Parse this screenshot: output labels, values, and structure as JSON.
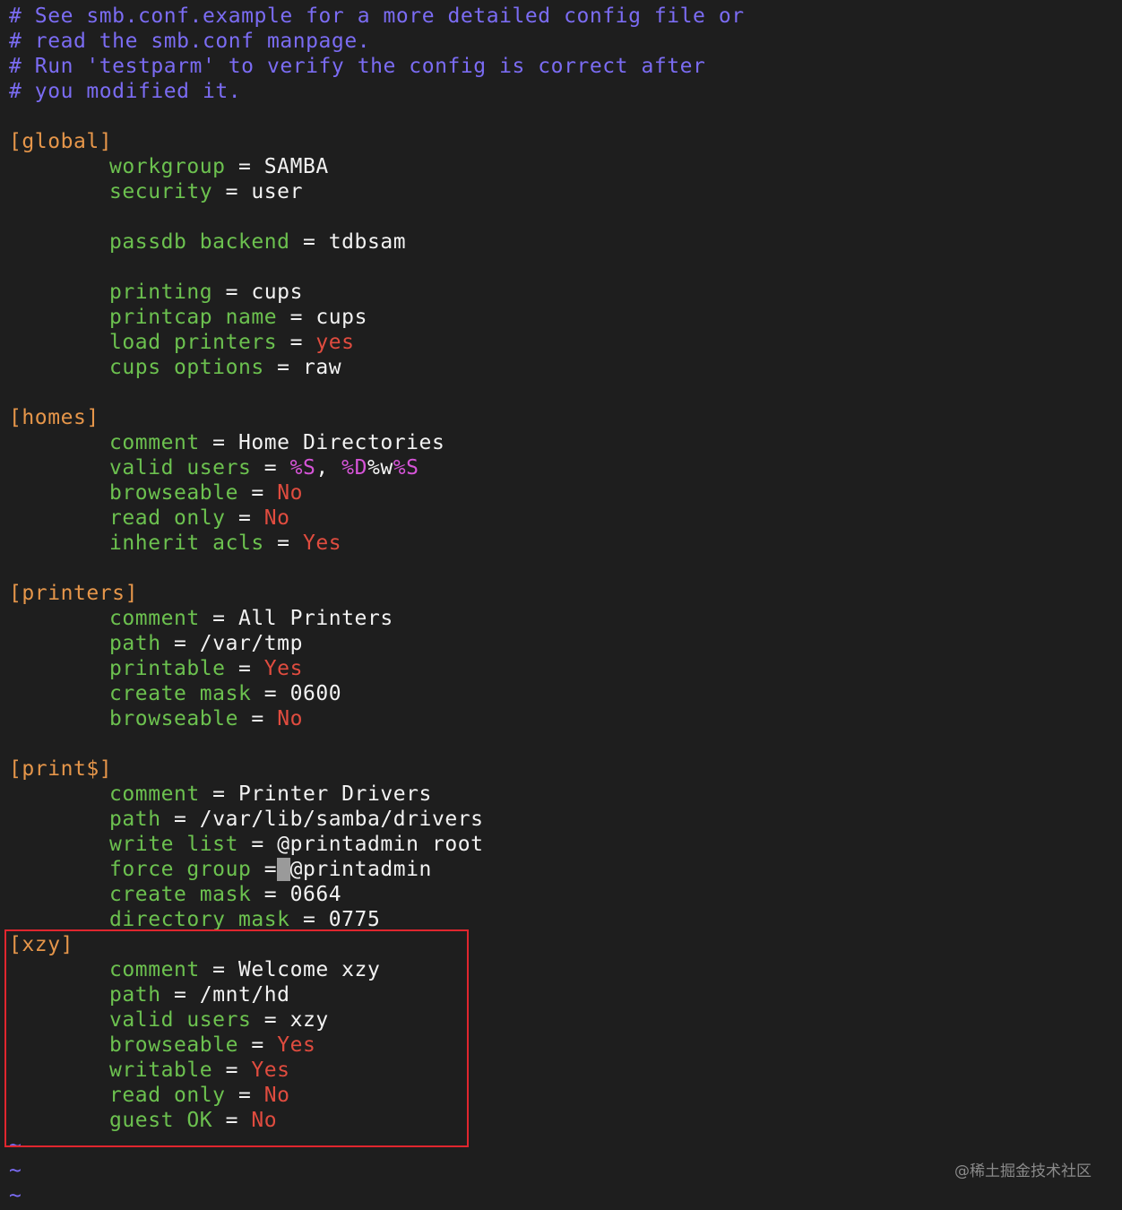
{
  "editor": {
    "lines": [
      {
        "kind": "comment",
        "text": "# See smb.conf.example for a more detailed config file or"
      },
      {
        "kind": "comment",
        "text": "# read the smb.conf manpage."
      },
      {
        "kind": "comment",
        "text": "# Run 'testparm' to verify the config is correct after"
      },
      {
        "kind": "comment",
        "text": "# you modified it."
      },
      {
        "kind": "blank"
      },
      {
        "kind": "section",
        "text": "[global]"
      },
      {
        "kind": "kv",
        "key": "workgroup",
        "parts": [
          {
            "t": "SAMBA",
            "c": "val"
          }
        ]
      },
      {
        "kind": "kv",
        "key": "security",
        "parts": [
          {
            "t": "user",
            "c": "val"
          }
        ]
      },
      {
        "kind": "blank"
      },
      {
        "kind": "kv",
        "key": "passdb backend",
        "parts": [
          {
            "t": "tdbsam",
            "c": "val"
          }
        ]
      },
      {
        "kind": "blank"
      },
      {
        "kind": "kv",
        "key": "printing",
        "parts": [
          {
            "t": "cups",
            "c": "val"
          }
        ]
      },
      {
        "kind": "kv",
        "key": "printcap name",
        "parts": [
          {
            "t": "cups",
            "c": "val"
          }
        ]
      },
      {
        "kind": "kv",
        "key": "load printers",
        "parts": [
          {
            "t": "yes",
            "c": "bool"
          }
        ]
      },
      {
        "kind": "kv",
        "key": "cups options",
        "parts": [
          {
            "t": "raw",
            "c": "val"
          }
        ]
      },
      {
        "kind": "blank"
      },
      {
        "kind": "section",
        "text": "[homes]"
      },
      {
        "kind": "kv",
        "key": "comment",
        "parts": [
          {
            "t": "Home Directories",
            "c": "val"
          }
        ]
      },
      {
        "kind": "kv",
        "key": "valid users",
        "parts": [
          {
            "t": "%S",
            "c": "macro"
          },
          {
            "t": ", ",
            "c": "val"
          },
          {
            "t": "%D",
            "c": "macro"
          },
          {
            "t": "%w",
            "c": "val"
          },
          {
            "t": "%S",
            "c": "macro"
          }
        ]
      },
      {
        "kind": "kv",
        "key": "browseable",
        "parts": [
          {
            "t": "No",
            "c": "bool"
          }
        ]
      },
      {
        "kind": "kv",
        "key": "read only",
        "parts": [
          {
            "t": "No",
            "c": "bool"
          }
        ]
      },
      {
        "kind": "kv",
        "key": "inherit acls",
        "parts": [
          {
            "t": "Yes",
            "c": "bool"
          }
        ]
      },
      {
        "kind": "blank"
      },
      {
        "kind": "section",
        "text": "[printers]"
      },
      {
        "kind": "kv",
        "key": "comment",
        "parts": [
          {
            "t": "All Printers",
            "c": "val"
          }
        ]
      },
      {
        "kind": "kv",
        "key": "path",
        "parts": [
          {
            "t": "/var/tmp",
            "c": "val"
          }
        ]
      },
      {
        "kind": "kv",
        "key": "printable",
        "parts": [
          {
            "t": "Yes",
            "c": "bool"
          }
        ]
      },
      {
        "kind": "kv",
        "key": "create mask",
        "parts": [
          {
            "t": "0600",
            "c": "val"
          }
        ]
      },
      {
        "kind": "kv",
        "key": "browseable",
        "parts": [
          {
            "t": "No",
            "c": "bool"
          }
        ]
      },
      {
        "kind": "blank"
      },
      {
        "kind": "section",
        "text": "[print$]"
      },
      {
        "kind": "kv",
        "key": "comment",
        "parts": [
          {
            "t": "Printer Drivers",
            "c": "val"
          }
        ]
      },
      {
        "kind": "kv",
        "key": "path",
        "parts": [
          {
            "t": "/var/lib/samba/drivers",
            "c": "val"
          }
        ]
      },
      {
        "kind": "kv",
        "key": "write list",
        "parts": [
          {
            "t": "@printadmin root",
            "c": "val"
          }
        ]
      },
      {
        "kind": "kv",
        "key": "force group",
        "cursor": true,
        "parts": [
          {
            "t": "@printadmin",
            "c": "val"
          }
        ]
      },
      {
        "kind": "kv",
        "key": "create mask",
        "parts": [
          {
            "t": "0664",
            "c": "val"
          }
        ]
      },
      {
        "kind": "kv",
        "key": "directory mask",
        "parts": [
          {
            "t": "0775",
            "c": "val"
          }
        ]
      },
      {
        "kind": "section",
        "text": "[xzy]"
      },
      {
        "kind": "kv",
        "key": "comment",
        "parts": [
          {
            "t": "Welcome xzy",
            "c": "val"
          }
        ]
      },
      {
        "kind": "kv",
        "key": "path",
        "parts": [
          {
            "t": "/mnt/hd",
            "c": "val"
          }
        ]
      },
      {
        "kind": "kv",
        "key": "valid users",
        "parts": [
          {
            "t": "xzy",
            "c": "val"
          }
        ]
      },
      {
        "kind": "kv",
        "key": "browseable",
        "parts": [
          {
            "t": "Yes",
            "c": "bool"
          }
        ]
      },
      {
        "kind": "kv",
        "key": "writable",
        "parts": [
          {
            "t": "Yes",
            "c": "bool"
          }
        ]
      },
      {
        "kind": "kv",
        "key": "read only",
        "parts": [
          {
            "t": "No",
            "c": "bool"
          }
        ]
      },
      {
        "kind": "kv",
        "key": "guest OK",
        "parts": [
          {
            "t": "No",
            "c": "bool"
          }
        ]
      },
      {
        "kind": "tilde",
        "text": "~"
      },
      {
        "kind": "tilde",
        "text": "~"
      },
      {
        "kind": "tilde",
        "text": "~"
      }
    ],
    "equals": " = "
  },
  "watermark": "@稀土掘金技术社区",
  "colors": {
    "background": "#1e1e1e",
    "comment": "#7b6cf3",
    "section": "#e6964a",
    "key": "#6cc14f",
    "value": "#f2f2f2",
    "boolean": "#e04c3f",
    "macro": "#d654d8",
    "highlight_box": "#e0262e"
  }
}
